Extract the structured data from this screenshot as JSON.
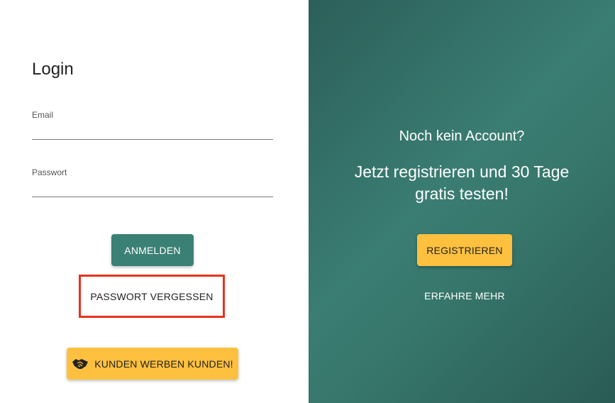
{
  "login": {
    "title": "Login",
    "email_label": "Email",
    "email_value": "",
    "password_label": "Passwort",
    "password_value": "",
    "login_button": "ANMELDEN",
    "forgot_button": "PASSWORT VERGESSEN",
    "referral_button": "KUNDEN WERBEN KUNDEN!",
    "referral_icon": "handshake-icon",
    "highlight_color": "#e8321e"
  },
  "promo": {
    "question": "Noch kein Account?",
    "headline": "Jetzt registrieren und 30 Tage gratis testen!",
    "register_button": "REGISTRIEREN",
    "learn_more_button": "ERFAHRE MEHR"
  },
  "colors": {
    "primary": "#3b8074",
    "accent": "#fec03f",
    "panel": "#2f6a62"
  }
}
